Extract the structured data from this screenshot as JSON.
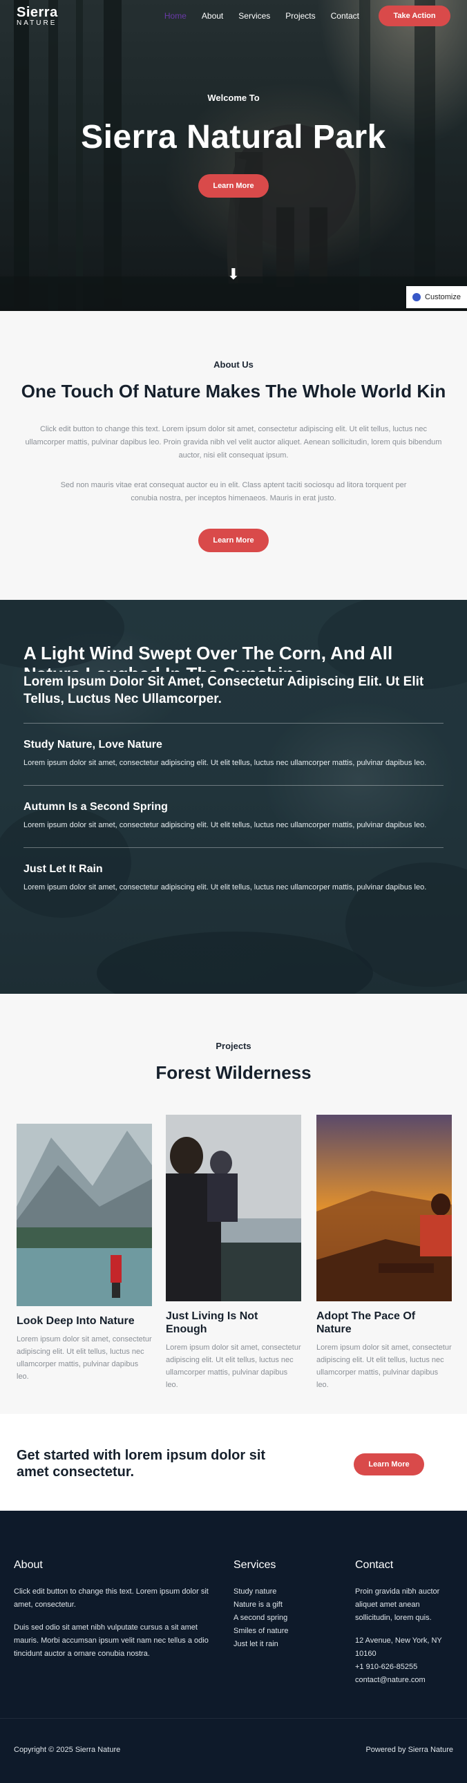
{
  "nav": {
    "logo_line1": "Sierra",
    "logo_line2": "NATURE",
    "items": [
      "Home",
      "About",
      "Services",
      "Projects",
      "Contact"
    ],
    "cta_label": "Take Action",
    "accent_color": "#d94a4a"
  },
  "hero": {
    "kicker": "Welcome To",
    "title": "Sierra Natural Park",
    "button_label": "Learn More",
    "arrow": "⬇",
    "customize_label": "Customize"
  },
  "about": {
    "kicker": "About Us",
    "title": "One Touch Of Nature Makes The Whole World Kin",
    "paragraph1": "Click edit button to change this text. Lorem ipsum dolor sit amet, consectetur adipiscing elit. Ut elit tellus, luctus nec ullamcorper mattis, pulvinar dapibus leo. Proin gravida nibh vel velit auctor aliquet. Aenean sollicitudin, lorem quis bibendum auctor, nisi elit consequat ipsum.",
    "paragraph2": "Sed non mauris vitae erat consequat auctor eu in elit. Class aptent taciti sociosqu ad litora torquent per conubia nostra, per inceptos himenaeos. Mauris in erat justo.",
    "button_label": "Learn More"
  },
  "features": {
    "headline": "A Light Wind Swept Over The Corn, And All Nature Laughed In The Sunshine",
    "subheadline": "Lorem Ipsum Dolor Sit Amet, Consectetur Adipiscing Elit. Ut Elit Tellus, Luctus Nec Ullamcorper.",
    "items": [
      {
        "title": "Study Nature, Love Nature",
        "text": "Lorem ipsum dolor sit amet, consectetur adipiscing elit. Ut elit tellus, luctus nec ullamcorper mattis, pulvinar dapibus leo."
      },
      {
        "title": "Autumn Is a Second Spring",
        "text": "Lorem ipsum dolor sit amet, consectetur adipiscing elit. Ut elit tellus, luctus nec ullamcorper mattis, pulvinar dapibus leo."
      },
      {
        "title": "Just Let It Rain",
        "text": "Lorem ipsum dolor sit amet, consectetur adipiscing elit. Ut elit tellus, luctus nec ullamcorper mattis, pulvinar dapibus leo."
      }
    ]
  },
  "projects": {
    "kicker": "Projects",
    "title": "Forest Wilderness",
    "cards": [
      {
        "title": "Look Deep Into Nature",
        "text": "Lorem ipsum dolor sit amet, consectetur adipiscing elit. Ut elit tellus, luctus nec ullamcorper mattis, pulvinar dapibus leo."
      },
      {
        "title": "Just Living Is Not Enough",
        "text": "Lorem ipsum dolor sit amet, consectetur adipiscing elit. Ut elit tellus, luctus nec ullamcorper mattis, pulvinar dapibus leo."
      },
      {
        "title": "Adopt The Pace Of Nature",
        "text": "Lorem ipsum dolor sit amet, consectetur adipiscing elit. Ut elit tellus, luctus nec ullamcorper mattis, pulvinar dapibus leo."
      }
    ]
  },
  "cta": {
    "text": "Get started with lorem ipsum dolor sit amet consectetur.",
    "button_label": "Learn More"
  },
  "footer": {
    "about_title": "About",
    "about_p1": "Click edit button to change this text. Lorem ipsum dolor sit amet, consectetur.",
    "about_p2": "Duis sed odio sit amet nibh vulputate cursus a sit amet mauris. Morbi accumsan ipsum velit nam nec tellus a odio tincidunt auctor a ornare conubia nostra.",
    "services_title": "Services",
    "services": [
      "Study nature",
      "Nature is a gift",
      "A second spring",
      "Smiles of nature",
      "Just let it rain"
    ],
    "contact_title": "Contact",
    "contact_p1": "Proin gravida nibh auctor aliquet amet anean sollicitudin, lorem quis.",
    "address": "12 Avenue, New York, NY 10160",
    "phone": "+1 910-626-85255",
    "email": "contact@nature.com",
    "copyright": "Copyright © 2025 Sierra Nature",
    "powered": "Powered by Sierra Nature",
    "bg_color": "#0e1a2a"
  }
}
